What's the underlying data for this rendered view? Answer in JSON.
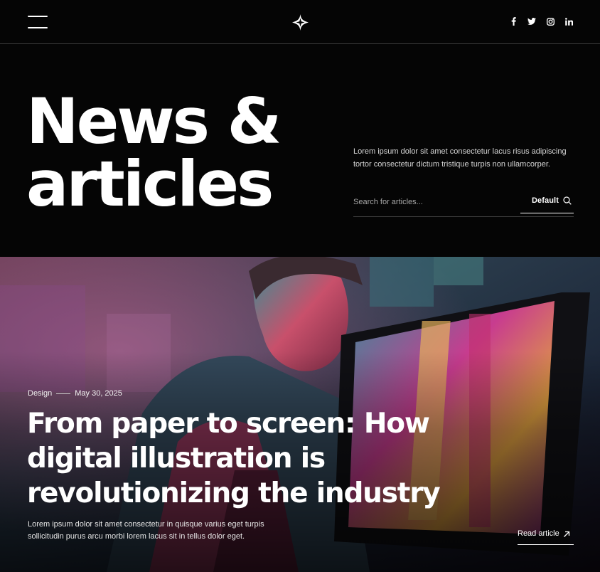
{
  "header": {
    "menu_icon": "hamburger-icon",
    "logo_icon": "four-point-star-logo",
    "social_icons": [
      "facebook-icon",
      "twitter-icon",
      "instagram-icon",
      "linkedin-icon"
    ]
  },
  "hero": {
    "title_line1": "News &",
    "title_line2": "articles",
    "intro": "Lorem ipsum dolor sit amet consectetur lacus risus adipiscing tortor consectetur dictum tristique turpis non ullamcorper.",
    "search": {
      "placeholder": "Search for articles...",
      "value": "",
      "sort_label": "Default",
      "sort_icon": "search-icon"
    }
  },
  "featured": {
    "category": "Design",
    "date": "May 30, 2025",
    "title": "From paper to screen: How digital illustration is revolutionizing the industry",
    "excerpt": "Lorem ipsum dolor sit amet consectetur in quisque varius eget turpis sollicitudin purus arcu morbi lorem lacus sit in tellus dolor eget.",
    "cta_label": "Read article",
    "cta_icon": "arrow-up-right-icon"
  },
  "colors": {
    "background": "#050505",
    "text": "#ffffff",
    "divider": "#3a3a3a"
  }
}
